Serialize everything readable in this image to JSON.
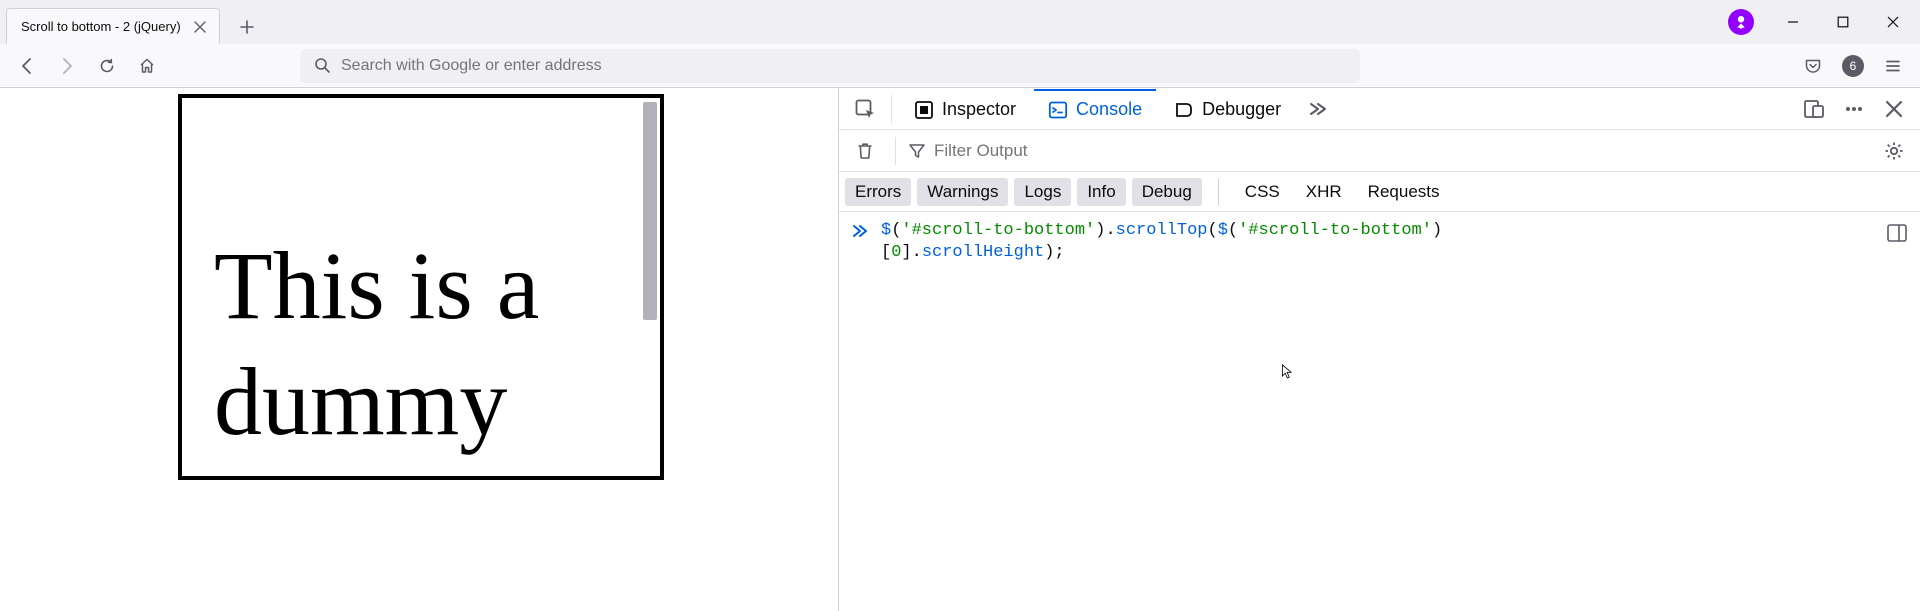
{
  "tab": {
    "title": "Scroll to bottom - 2 (jQuery)"
  },
  "urlbar": {
    "placeholder": "Search with Google or enter address"
  },
  "extensions_badge": "6",
  "page": {
    "box_text_line1": "This is a",
    "box_text_line2": "dummy"
  },
  "devtools": {
    "tabs": {
      "inspector": "Inspector",
      "console": "Console",
      "debugger": "Debugger"
    },
    "filter_placeholder": "Filter Output",
    "categories": {
      "errors": "Errors",
      "warnings": "Warnings",
      "logs": "Logs",
      "info": "Info",
      "debug": "Debug",
      "css": "CSS",
      "xhr": "XHR",
      "requests": "Requests"
    },
    "console_input": {
      "tok1": "$",
      "tok2": "(",
      "tok3": "'#scroll-to-bottom'",
      "tok4": ").",
      "tok5": "scrollTop",
      "tok6": "(",
      "tok7": "$",
      "tok8": "(",
      "tok9": "'#scroll-to-bottom'",
      "tok10": ")",
      "tok11": "[",
      "tok12": "0",
      "tok13": "].",
      "tok14": "scrollHeight",
      "tok15": ");"
    }
  }
}
